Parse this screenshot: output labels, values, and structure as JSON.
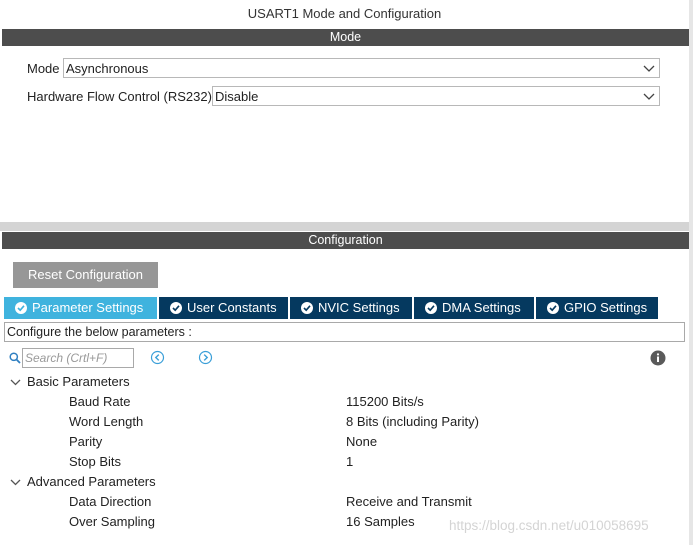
{
  "window": {
    "title": "USART1 Mode and Configuration"
  },
  "mode_section": {
    "header": "Mode",
    "fields": [
      {
        "label": "Mode",
        "value": "Asynchronous"
      },
      {
        "label": "Hardware Flow Control (RS232)",
        "value": "Disable"
      }
    ]
  },
  "config_section": {
    "header": "Configuration",
    "reset_label": "Reset Configuration",
    "tabs": [
      {
        "label": "Parameter Settings",
        "active": true
      },
      {
        "label": "User Constants",
        "active": false
      },
      {
        "label": "NVIC Settings",
        "active": false
      },
      {
        "label": "DMA Settings",
        "active": false
      },
      {
        "label": "GPIO Settings",
        "active": false
      }
    ],
    "instructions": "Configure the below parameters :",
    "search": {
      "placeholder": "Search (Crtl+F)"
    },
    "groups": [
      {
        "title": "Basic Parameters",
        "params": [
          {
            "name": "Baud Rate",
            "value": "115200 Bits/s"
          },
          {
            "name": "Word Length",
            "value": "8 Bits (including Parity)"
          },
          {
            "name": "Parity",
            "value": "None"
          },
          {
            "name": "Stop Bits",
            "value": "1"
          }
        ]
      },
      {
        "title": "Advanced Parameters",
        "params": [
          {
            "name": "Data Direction",
            "value": "Receive and Transmit"
          },
          {
            "name": "Over Sampling",
            "value": "16 Samples"
          }
        ]
      }
    ]
  },
  "watermark": "https://blog.csdn.net/u010058695",
  "colors": {
    "section_bar": "#4d4d4d",
    "tab_active": "#3fb3de",
    "tab_inactive": "#05395f",
    "reset_button": "#979797",
    "nav_arrow": "#3b9fd8"
  },
  "icons": {
    "search": "search-icon",
    "prev": "circle-arrow-left-icon",
    "next": "circle-arrow-right-icon",
    "info": "info-icon",
    "expand": "chevron-down-icon",
    "dropdown": "chevron-down-icon",
    "tab_status": "check-circle-icon"
  }
}
